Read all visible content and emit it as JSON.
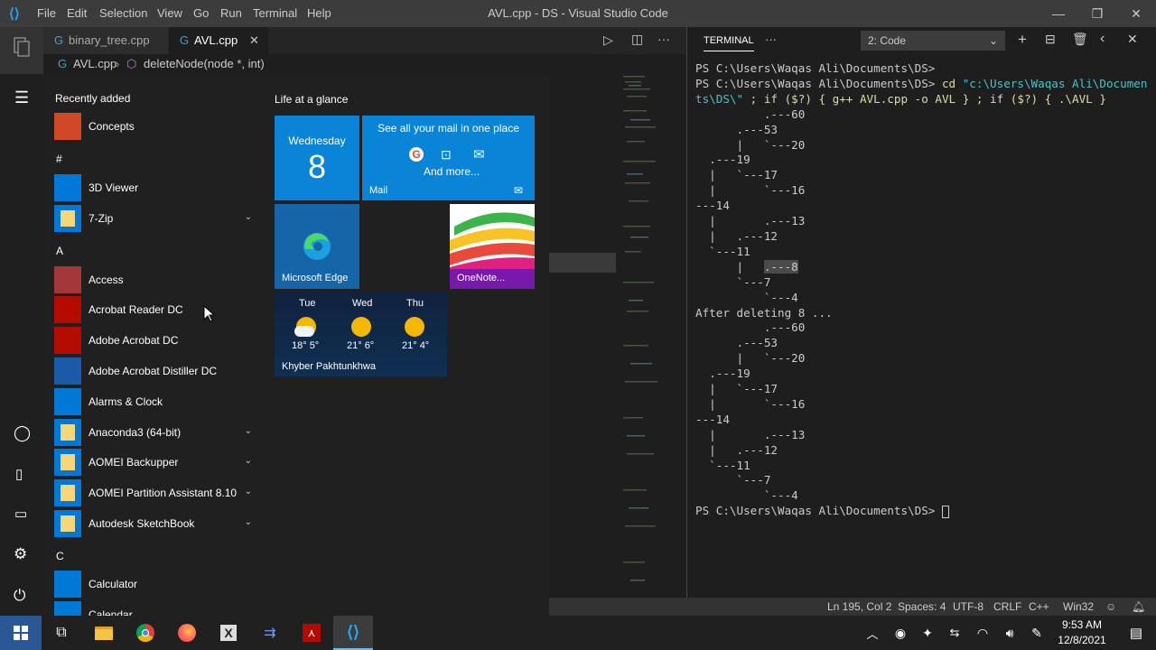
{
  "window": {
    "title": "AVL.cpp - DS - Visual Studio Code",
    "menu": [
      "File",
      "Edit",
      "Selection",
      "View",
      "Go",
      "Run",
      "Terminal",
      "Help"
    ]
  },
  "editor": {
    "tabs": [
      {
        "label": "binary_tree.cpp",
        "active": false
      },
      {
        "label": "AVL.cpp",
        "active": true
      }
    ],
    "breadcrumb": {
      "file": "AVL.cpp",
      "symbol": "deleteNode(node *, int)"
    }
  },
  "panel": {
    "tab": "TERMINAL",
    "more": "···",
    "terminal_select": "2: Code",
    "lines": [
      "PS C:\\Users\\Waqas Ali\\Documents\\DS>",
      "PS C:\\Users\\Waqas Ali\\Documents\\DS> cd \"c:\\Users\\Waqas Ali\\Documen",
      "ts\\DS\\\" ; if ($?) { g++ AVL.cpp -o AVL } ; if ($?) { .\\AVL }",
      "          .---60",
      "      .---53",
      "      |   `---20",
      "  .---19",
      "  |   `---17",
      "  |       `---16",
      "---14",
      "  |       .---13",
      "  |   .---12",
      "  `---11",
      "      |   .---8",
      "      `---7",
      "          `---4",
      "After deleting 8 ...",
      "          .---60",
      "      .---53",
      "      |   `---20",
      "  .---19",
      "  |   `---17",
      "  |       `---16",
      "---14",
      "  |       .---13",
      "  |   .---12",
      "  `---11",
      "      `---7",
      "          `---4",
      "PS C:\\Users\\Waqas Ali\\Documents\\DS> "
    ]
  },
  "statusbar": {
    "position": "Ln 195, Col 2",
    "spaces": "Spaces: 4",
    "encoding": "UTF-8",
    "eol": "CRLF",
    "language": "C++",
    "platform": "Win32"
  },
  "startmenu": {
    "recently_added": "Recently added",
    "life_at_a_glance": "Life at a glance",
    "letters": [
      "#",
      "A",
      "C"
    ],
    "apps": [
      {
        "label": "Concepts",
        "color": "#d24726"
      },
      {
        "label": "3D Viewer",
        "color": "#0078d7"
      },
      {
        "label": "7-Zip",
        "color": "#f5d77a"
      },
      {
        "label": "Access",
        "color": "#a4373a"
      },
      {
        "label": "Acrobat Reader DC",
        "color": "#b30b00"
      },
      {
        "label": "Adobe Acrobat DC",
        "color": "#b30b00"
      },
      {
        "label": "Adobe Acrobat Distiller DC",
        "color": "#1a5aa8"
      },
      {
        "label": "Alarms & Clock",
        "color": "#0078d7"
      },
      {
        "label": "Anaconda3 (64-bit)",
        "color": "#f5d77a"
      },
      {
        "label": "AOMEI Backupper",
        "color": "#f5d77a"
      },
      {
        "label": "AOMEI Partition Assistant 8.10",
        "color": "#f5d77a"
      },
      {
        "label": "Autodesk SketchBook",
        "color": "#f5d77a"
      },
      {
        "label": "Calculator",
        "color": "#0078d7"
      },
      {
        "label": "Calendar",
        "color": "#0078d7"
      }
    ],
    "tiles": {
      "calendar_day": "Wednesday",
      "calendar_date": "8",
      "mail_heading": "See all your mail in one place",
      "mail_more": "And more...",
      "mail_label": "Mail",
      "edge_label": "Microsoft Edge",
      "onenote_label": "OneNote...",
      "weather_days": [
        {
          "day": "Tue",
          "temp": "18° 5°"
        },
        {
          "day": "Wed",
          "temp": "21° 6°"
        },
        {
          "day": "Thu",
          "temp": "21° 4°"
        }
      ],
      "weather_location": "Khyber Pakhtunkhwa"
    }
  },
  "taskbar": {
    "time": "9:53 AM",
    "date": "12/8/2021"
  }
}
